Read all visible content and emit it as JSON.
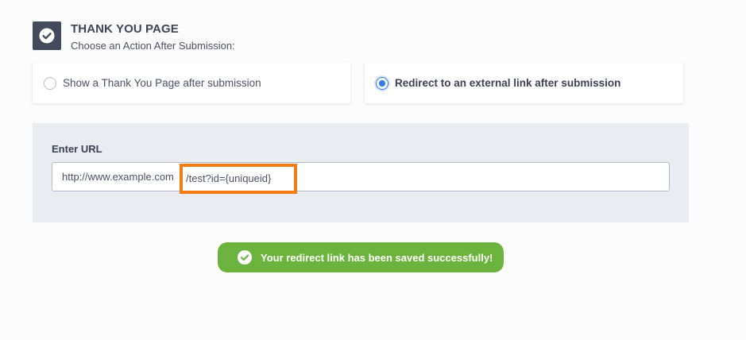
{
  "header": {
    "icon": "checkmark-circle-icon",
    "title": "THANK YOU PAGE",
    "subtitle": "Choose an Action After Submission:"
  },
  "options": [
    {
      "label": "Show a Thank You Page after submission",
      "selected": false
    },
    {
      "label": "Redirect to an external link after submission",
      "selected": true
    }
  ],
  "url_section": {
    "label": "Enter URL",
    "value_base": "http://www.example.com",
    "value_highlight": "/test?id={uniqueid}"
  },
  "toast": {
    "icon": "checkmark-circle-icon",
    "message": "Your redirect link has been saved successfully!"
  },
  "colors": {
    "accent_blue": "#2f7cf6",
    "highlight_orange": "#f57c12",
    "success_green": "#6cb33e",
    "header_icon_bg": "#434a5e"
  }
}
